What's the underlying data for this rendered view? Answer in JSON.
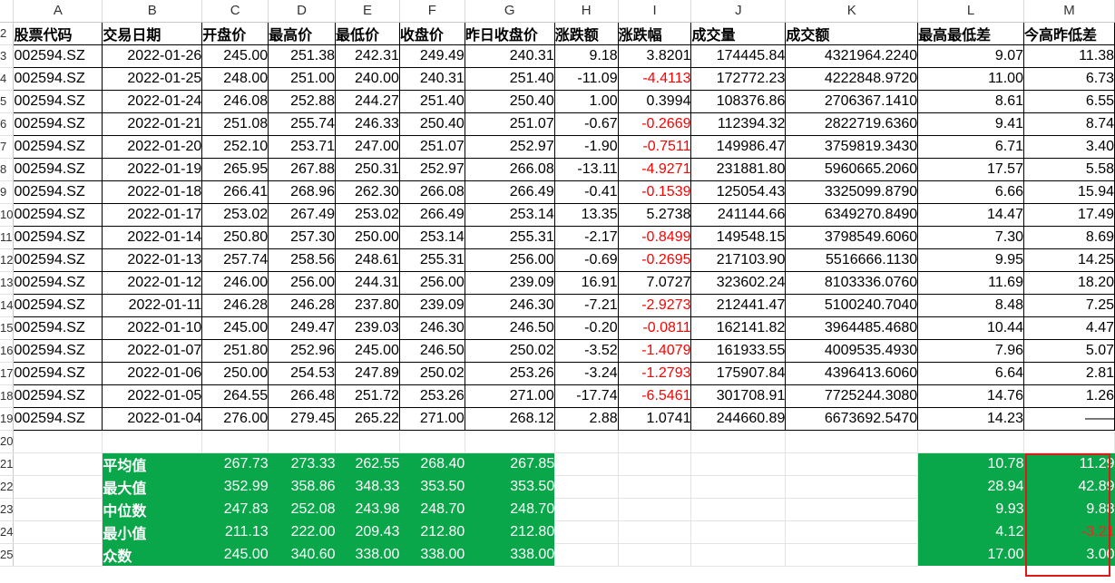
{
  "column_letters": [
    "A",
    "B",
    "C",
    "D",
    "E",
    "F",
    "G",
    "H",
    "I",
    "J",
    "K",
    "L",
    "M"
  ],
  "headers": [
    "股票代码",
    "交易日期",
    "开盘价",
    "最高价",
    "最低价",
    "收盘价",
    "昨日收盘价",
    "涨跌额",
    "涨跌幅",
    "成交量",
    "成交额",
    "最高最低差",
    "今高昨低差"
  ],
  "row_numbers": [
    "2",
    "3",
    "4",
    "5",
    "6",
    "7",
    "8",
    "9",
    "10",
    "11",
    "12",
    "13",
    "14",
    "15",
    "16",
    "17",
    "18",
    "19",
    "20",
    "21",
    "22",
    "23",
    "24",
    "25"
  ],
  "rows": [
    {
      "code": "002594.SZ",
      "date": "2022-01-26",
      "open": "245.00",
      "high": "251.38",
      "low": "242.31",
      "close": "249.49",
      "prev": "240.31",
      "chg": "9.18",
      "pct": "3.8201",
      "vol": "174445.84",
      "amt": "4321964.2240",
      "hl": "9.07",
      "hpl": "11.38"
    },
    {
      "code": "002594.SZ",
      "date": "2022-01-25",
      "open": "248.00",
      "high": "251.00",
      "low": "240.00",
      "close": "240.31",
      "prev": "251.40",
      "chg": "-11.09",
      "pct": "-4.4113",
      "vol": "172772.23",
      "amt": "4222848.9720",
      "hl": "11.00",
      "hpl": "6.73"
    },
    {
      "code": "002594.SZ",
      "date": "2022-01-24",
      "open": "246.08",
      "high": "252.88",
      "low": "244.27",
      "close": "251.40",
      "prev": "250.40",
      "chg": "1.00",
      "pct": "0.3994",
      "vol": "108376.86",
      "amt": "2706367.1410",
      "hl": "8.61",
      "hpl": "6.55"
    },
    {
      "code": "002594.SZ",
      "date": "2022-01-21",
      "open": "251.08",
      "high": "255.74",
      "low": "246.33",
      "close": "250.40",
      "prev": "251.07",
      "chg": "-0.67",
      "pct": "-0.2669",
      "vol": "112394.32",
      "amt": "2822719.6360",
      "hl": "9.41",
      "hpl": "8.74"
    },
    {
      "code": "002594.SZ",
      "date": "2022-01-20",
      "open": "252.10",
      "high": "253.71",
      "low": "247.00",
      "close": "251.07",
      "prev": "252.97",
      "chg": "-1.90",
      "pct": "-0.7511",
      "vol": "149986.47",
      "amt": "3759819.3430",
      "hl": "6.71",
      "hpl": "3.40"
    },
    {
      "code": "002594.SZ",
      "date": "2022-01-19",
      "open": "265.95",
      "high": "267.88",
      "low": "250.31",
      "close": "252.97",
      "prev": "266.08",
      "chg": "-13.11",
      "pct": "-4.9271",
      "vol": "231881.80",
      "amt": "5960665.2060",
      "hl": "17.57",
      "hpl": "5.58"
    },
    {
      "code": "002594.SZ",
      "date": "2022-01-18",
      "open": "266.41",
      "high": "268.96",
      "low": "262.30",
      "close": "266.08",
      "prev": "266.49",
      "chg": "-0.41",
      "pct": "-0.1539",
      "vol": "125054.43",
      "amt": "3325099.8790",
      "hl": "6.66",
      "hpl": "15.94"
    },
    {
      "code": "002594.SZ",
      "date": "2022-01-17",
      "open": "253.02",
      "high": "267.49",
      "low": "253.02",
      "close": "266.49",
      "prev": "253.14",
      "chg": "13.35",
      "pct": "5.2738",
      "vol": "241144.66",
      "amt": "6349270.8490",
      "hl": "14.47",
      "hpl": "17.49"
    },
    {
      "code": "002594.SZ",
      "date": "2022-01-14",
      "open": "250.80",
      "high": "257.30",
      "low": "250.00",
      "close": "253.14",
      "prev": "255.31",
      "chg": "-2.17",
      "pct": "-0.8499",
      "vol": "149548.15",
      "amt": "3798549.6060",
      "hl": "7.30",
      "hpl": "8.69"
    },
    {
      "code": "002594.SZ",
      "date": "2022-01-13",
      "open": "257.74",
      "high": "258.56",
      "low": "248.61",
      "close": "255.31",
      "prev": "256.00",
      "chg": "-0.69",
      "pct": "-0.2695",
      "vol": "217103.90",
      "amt": "5516666.1130",
      "hl": "9.95",
      "hpl": "14.25"
    },
    {
      "code": "002594.SZ",
      "date": "2022-01-12",
      "open": "246.00",
      "high": "256.00",
      "low": "244.31",
      "close": "256.00",
      "prev": "239.09",
      "chg": "16.91",
      "pct": "7.0727",
      "vol": "323602.24",
      "amt": "8103336.0760",
      "hl": "11.69",
      "hpl": "18.20"
    },
    {
      "code": "002594.SZ",
      "date": "2022-01-11",
      "open": "246.28",
      "high": "246.28",
      "low": "237.80",
      "close": "239.09",
      "prev": "246.30",
      "chg": "-7.21",
      "pct": "-2.9273",
      "vol": "212441.47",
      "amt": "5100240.7040",
      "hl": "8.48",
      "hpl": "7.25"
    },
    {
      "code": "002594.SZ",
      "date": "2022-01-10",
      "open": "245.00",
      "high": "249.47",
      "low": "239.03",
      "close": "246.30",
      "prev": "246.50",
      "chg": "-0.20",
      "pct": "-0.0811",
      "vol": "162141.82",
      "amt": "3964485.4680",
      "hl": "10.44",
      "hpl": "4.47"
    },
    {
      "code": "002594.SZ",
      "date": "2022-01-07",
      "open": "251.80",
      "high": "252.96",
      "low": "245.00",
      "close": "246.50",
      "prev": "250.02",
      "chg": "-3.52",
      "pct": "-1.4079",
      "vol": "161933.55",
      "amt": "4009535.4930",
      "hl": "7.96",
      "hpl": "5.07"
    },
    {
      "code": "002594.SZ",
      "date": "2022-01-06",
      "open": "250.00",
      "high": "254.53",
      "low": "247.89",
      "close": "250.02",
      "prev": "253.26",
      "chg": "-3.24",
      "pct": "-1.2793",
      "vol": "175907.84",
      "amt": "4396413.6060",
      "hl": "6.64",
      "hpl": "2.81"
    },
    {
      "code": "002594.SZ",
      "date": "2022-01-05",
      "open": "264.55",
      "high": "266.48",
      "low": "251.72",
      "close": "253.26",
      "prev": "271.00",
      "chg": "-17.74",
      "pct": "-6.5461",
      "vol": "301708.91",
      "amt": "7725244.3080",
      "hl": "14.76",
      "hpl": "1.26"
    },
    {
      "code": "002594.SZ",
      "date": "2022-01-04",
      "open": "276.00",
      "high": "279.45",
      "low": "265.22",
      "close": "271.00",
      "prev": "268.12",
      "chg": "2.88",
      "pct": "1.0741",
      "vol": "244660.89",
      "amt": "6673692.5470",
      "hl": "14.23",
      "hpl": "——"
    }
  ],
  "stats": [
    {
      "label": "平均值",
      "open": "267.73",
      "high": "273.33",
      "low": "262.55",
      "close": "268.40",
      "prev": "267.85",
      "hl": "10.78",
      "hpl": "11.29"
    },
    {
      "label": "最大值",
      "open": "352.99",
      "high": "358.86",
      "low": "348.33",
      "close": "353.50",
      "prev": "353.50",
      "hl": "28.94",
      "hpl": "42.89"
    },
    {
      "label": "中位数",
      "open": "247.83",
      "high": "252.08",
      "low": "243.98",
      "close": "248.70",
      "prev": "248.70",
      "hl": "9.93",
      "hpl": "9.88"
    },
    {
      "label": "最小值",
      "open": "211.13",
      "high": "222.00",
      "low": "209.43",
      "close": "212.80",
      "prev": "212.80",
      "hl": "4.12",
      "hpl": "-3.21"
    },
    {
      "label": "众数",
      "open": "245.00",
      "high": "340.60",
      "low": "338.00",
      "close": "338.00",
      "prev": "338.00",
      "hl": "17.00",
      "hpl": "3.00"
    }
  ],
  "colors": {
    "stat_fill": "#0aa64a",
    "negative_text": "#ff0000",
    "selection_border": "#e01818"
  }
}
